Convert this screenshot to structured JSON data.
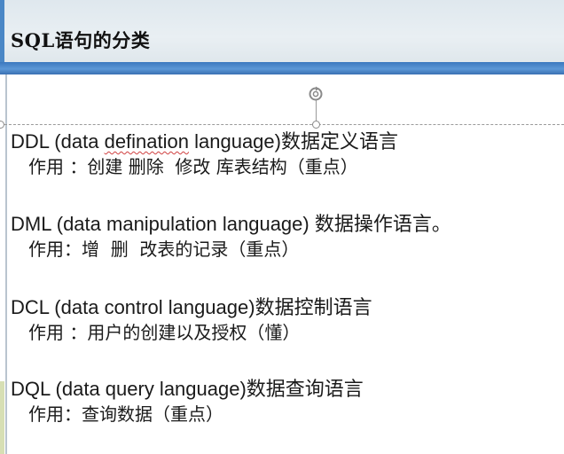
{
  "slide": {
    "title": "SQL语句的分类",
    "accent_color": "#4a87c6",
    "header_bg": "#e5ecf1",
    "rotate_icon": "rotate-handle-icon"
  },
  "sections": [
    {
      "heading_prefix": "DDL (data ",
      "heading_misspelled": "defination",
      "heading_suffix": " language)数据定义语言",
      "detail": "作用 ：创建 删除  修改 库表结构（重点）"
    },
    {
      "heading": "DML (data manipulation language) 数据操作语言。",
      "detail": "作用：增  删  改表的记录（重点）"
    },
    {
      "heading": "DCL (data control language)数据控制语言",
      "detail": "作用 ：用户的创建以及授权（懂）"
    },
    {
      "heading": "DQL (data query language)数据查询语言",
      "detail": "作用：查询数据（重点）"
    }
  ]
}
